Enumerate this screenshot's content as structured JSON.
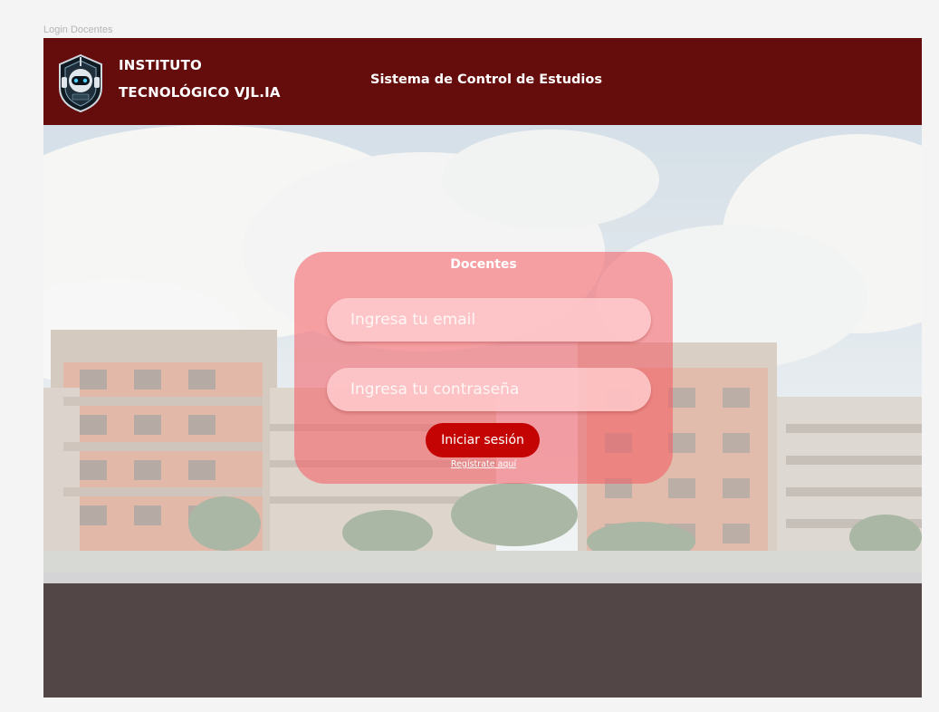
{
  "frame": {
    "label": "Login Docentes"
  },
  "header": {
    "brand_line_1": "INSTITUTO",
    "brand_line_2": "TECNOLÓGICO VJL.IA",
    "system_title": "Sistema de Control de Estudios",
    "logo_icon": "robot-shield-icon",
    "color": "#650c0c"
  },
  "login": {
    "title": "Docentes",
    "email_placeholder": "Ingresa tu email",
    "password_placeholder": "Ingresa tu contraseña",
    "submit_label": "Iniciar sesión",
    "register_link": "Regístrate aquí",
    "button_color": "#c40303"
  },
  "footer": {
    "color": "#524646"
  }
}
